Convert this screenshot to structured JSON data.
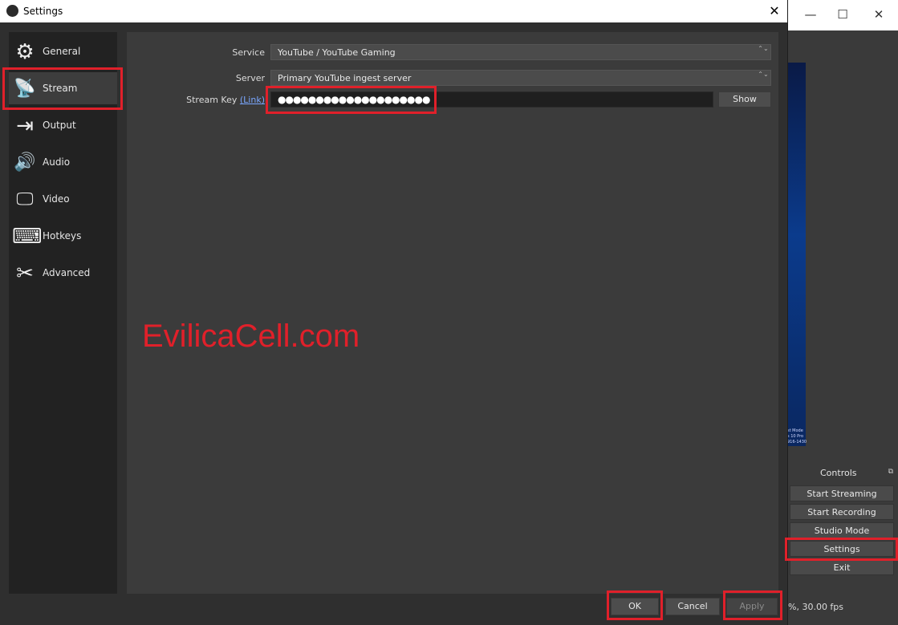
{
  "main_window": {
    "minimize_glyph": "—",
    "maximize_glyph": "☐",
    "close_glyph": "✕",
    "preview_text": "st Mode\ns 10 Pro\n916-1430",
    "controls": {
      "header": "Controls",
      "pin_glyph": "⧉",
      "buttons": [
        "Start Streaming",
        "Start Recording",
        "Studio Mode",
        "Settings",
        "Exit"
      ]
    },
    "status": "%, 30.00 fps"
  },
  "dialog": {
    "title": "Settings",
    "close_glyph": "✕",
    "sidebar": [
      {
        "label": "General",
        "icon": "gear-icon",
        "glyph": "⚙"
      },
      {
        "label": "Stream",
        "icon": "antenna-icon",
        "glyph": "📡"
      },
      {
        "label": "Output",
        "icon": "output-icon",
        "glyph": "⇥"
      },
      {
        "label": "Audio",
        "icon": "speaker-icon",
        "glyph": "🔊"
      },
      {
        "label": "Video",
        "icon": "monitor-icon",
        "glyph": "🖵"
      },
      {
        "label": "Hotkeys",
        "icon": "keyboard-icon",
        "glyph": "⌨"
      },
      {
        "label": "Advanced",
        "icon": "tools-icon",
        "glyph": "✂"
      }
    ],
    "active_sidebar": "Stream",
    "form": {
      "service_label": "Service",
      "service_value": "YouTube / YouTube Gaming",
      "server_label": "Server",
      "server_value": "Primary YouTube ingest server",
      "stream_key_label": "Stream Key",
      "stream_key_link": "(Link)",
      "stream_key_value": "●●●●●●●●●●●●●●●●●●●●",
      "show_button": "Show",
      "combo_arrow": "⌃⌄"
    },
    "watermark": "EvilicaCell.com",
    "footer": {
      "ok": "OK",
      "cancel": "Cancel",
      "apply": "Apply"
    }
  },
  "colors": {
    "highlight": "#e0202a",
    "link": "#7aa7ff"
  }
}
